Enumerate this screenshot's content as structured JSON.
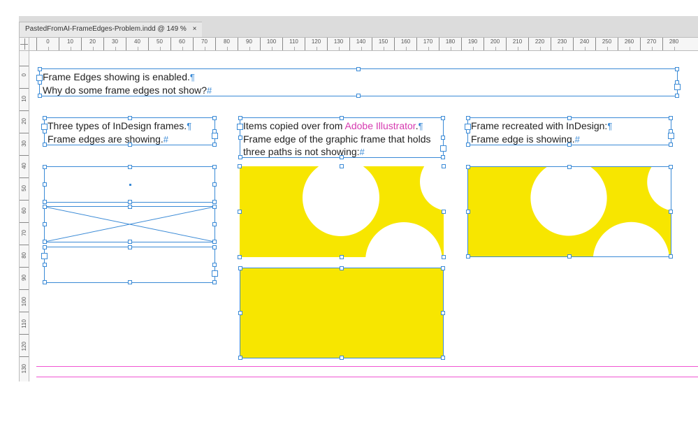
{
  "tab": {
    "title": "PastedFromAI-FrameEdges-Problem.indd @ 149 %",
    "close": "×"
  },
  "ruler_units": [
    "0",
    "10",
    "20",
    "30",
    "40",
    "50",
    "60",
    "70",
    "80",
    "90",
    "100",
    "110",
    "120",
    "130",
    "140",
    "150",
    "160",
    "170",
    "180",
    "190",
    "200",
    "210",
    "220",
    "230",
    "240",
    "250",
    "260",
    "270",
    "280"
  ],
  "vruler_units": [
    "0",
    "10",
    "20",
    "30",
    "40",
    "50",
    "60",
    "70",
    "80",
    "90",
    "100",
    "110",
    "120",
    "130"
  ],
  "intro": {
    "line1": "Frame Edges showing is enabled.",
    "line2": "Why do some frame edges not show?"
  },
  "col1": {
    "line1": "Three types of InDesign frames.",
    "line2": "Frame edges are showing."
  },
  "col2": {
    "line1a": "Items copied over from ",
    "line1b": "Adobe Illustrator",
    "line1c": ".",
    "line2": "Frame edge of the graphic frame that holds",
    "line3": "three paths is not showing:"
  },
  "col3": {
    "line1": "Frame recreated with InDesign:",
    "line2": "Frame edge is showing."
  },
  "colors": {
    "yellow": "#f7e600",
    "frame": "#3a8ad6",
    "guide": "#f055d2"
  }
}
